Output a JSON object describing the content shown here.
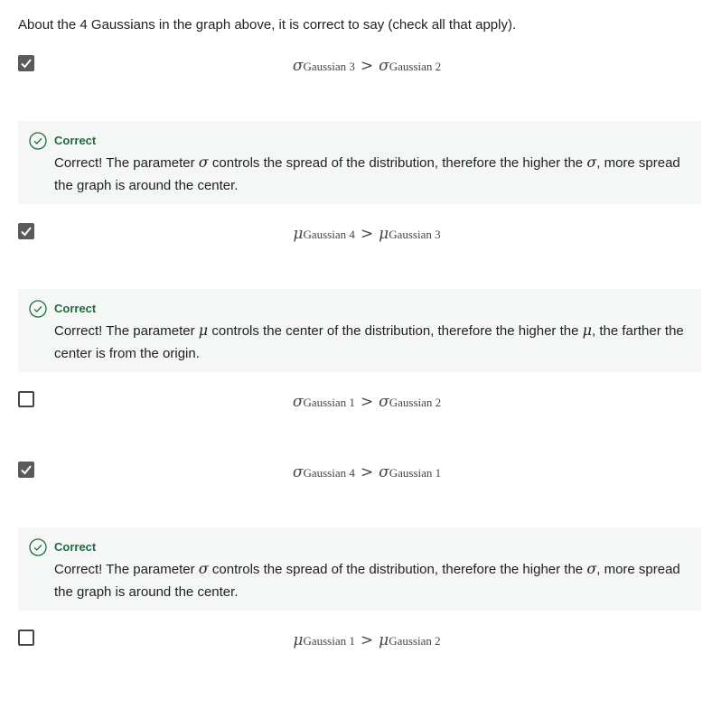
{
  "question": "About the 4 Gaussians in the graph above, it is correct to say (check all that apply).",
  "options": [
    {
      "checked": true,
      "lhs_symbol": "σ",
      "lhs_sub": "Gaussian 3",
      "op": ">",
      "rhs_symbol": "σ",
      "rhs_sub": "Gaussian 2",
      "feedback": {
        "title": "Correct",
        "text_before": "Correct! The parameter ",
        "symbol": "σ",
        "text_mid": " controls the spread of the distribution, therefore the higher the ",
        "text_after": ", more spread the graph is around the center."
      }
    },
    {
      "checked": true,
      "lhs_symbol": "μ",
      "lhs_sub": "Gaussian 4",
      "op": ">",
      "rhs_symbol": "μ",
      "rhs_sub": "Gaussian 3",
      "feedback": {
        "title": "Correct",
        "text_before": "Correct! The parameter ",
        "symbol": "μ",
        "text_mid": " controls the center of the distribution, therefore the higher the ",
        "text_after": ", the farther the center is from the origin."
      }
    },
    {
      "checked": false,
      "lhs_symbol": "σ",
      "lhs_sub": "Gaussian 1",
      "op": ">",
      "rhs_symbol": "σ",
      "rhs_sub": "Gaussian 2"
    },
    {
      "checked": true,
      "lhs_symbol": "σ",
      "lhs_sub": "Gaussian 4",
      "op": ">",
      "rhs_symbol": "σ",
      "rhs_sub": "Gaussian 1",
      "feedback": {
        "title": "Correct",
        "text_before": "Correct! The parameter ",
        "symbol": "σ",
        "text_mid": " controls the spread of the distribution, therefore the higher the ",
        "text_after": ", more spread the graph is around the center."
      }
    },
    {
      "checked": false,
      "lhs_symbol": "μ",
      "lhs_sub": "Gaussian 1",
      "op": ">",
      "rhs_symbol": "μ",
      "rhs_sub": "Gaussian 2"
    }
  ],
  "colors": {
    "checked_box": "#5a5a5a",
    "feedback_bg": "#f4f7f6",
    "correct_green": "#1f6b3f"
  }
}
